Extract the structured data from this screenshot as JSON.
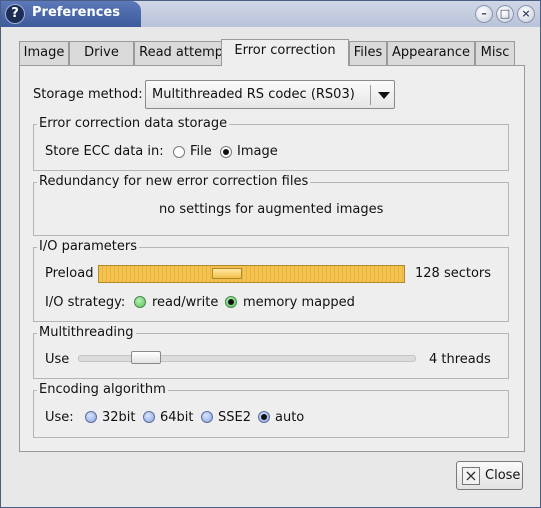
{
  "window": {
    "title": "Preferences"
  },
  "tabs": [
    {
      "label": "Image",
      "active": false
    },
    {
      "label": "Drive",
      "active": false
    },
    {
      "label": "Read attempts",
      "active": false
    },
    {
      "label": "Error correction",
      "active": true
    },
    {
      "label": "Files",
      "active": false
    },
    {
      "label": "Appearance",
      "active": false
    },
    {
      "label": "Misc",
      "active": false
    }
  ],
  "storage_method": {
    "label": "Storage method:",
    "value": "Multithreaded RS codec (RS03)"
  },
  "ecc_storage": {
    "title": "Error correction data storage",
    "label": "Store ECC data in:",
    "options": [
      "File",
      "Image"
    ],
    "selected": "Image"
  },
  "redundancy": {
    "title": "Redundancy for new error correction files",
    "message": "no settings for augmented images"
  },
  "io": {
    "title": "I/O parameters",
    "preload_label": "Preload",
    "preload_value": "128 sectors",
    "preload_level": 0.41,
    "strategy_label": "I/O strategy:",
    "options": [
      "read/write",
      "memory mapped"
    ],
    "selected": "memory mapped"
  },
  "multithreading": {
    "title": "Multithreading",
    "use_label": "Use",
    "value": "4 threads",
    "level": 0.17
  },
  "encoding": {
    "title": "Encoding algorithm",
    "use_label": "Use:",
    "options": [
      "32bit",
      "64bit",
      "SSE2",
      "auto"
    ],
    "selected": "auto"
  },
  "close_button": {
    "label": "Close"
  },
  "colors": {
    "title_bar": "#3d5a9a",
    "preload_track": "#f4c24e",
    "radio_green": "#58c458",
    "radio_blue": "#8aa6de"
  }
}
